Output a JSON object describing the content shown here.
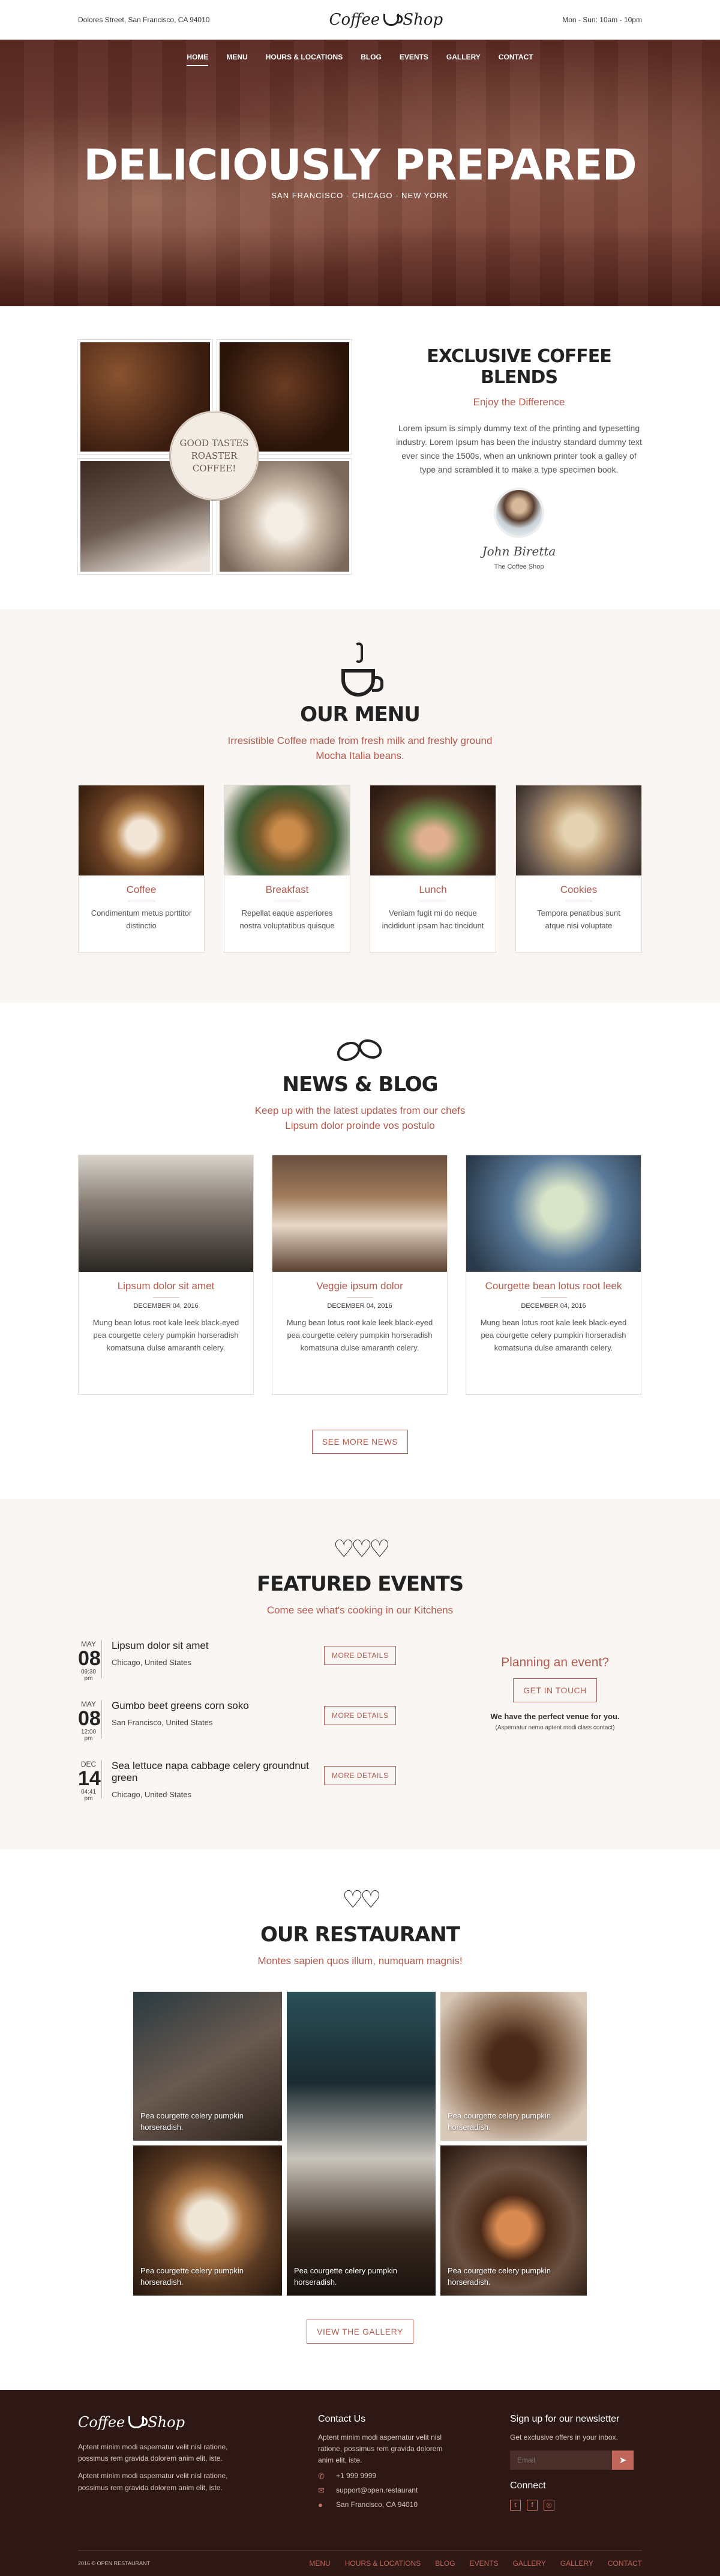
{
  "topbar": {
    "address": "Dolores Street, San Francisco, CA 94010",
    "brand_left": "Coffee",
    "brand_right": "Shop",
    "hours": "Mon - Sun: 10am - 10pm"
  },
  "nav": [
    "HOME",
    "MENU",
    "HOURS & LOCATIONS",
    "BLOG",
    "EVENTS",
    "GALLERY",
    "CONTACT"
  ],
  "hero": {
    "title": "DELICIOUSLY PREPARED",
    "subtitle": "SAN FRANCISCO - CHICAGO - NEW YORK"
  },
  "blends": {
    "badge_line1": "GOOD TASTES",
    "badge_line2": "ROASTER",
    "badge_line3": "COFFEE!",
    "title": "EXCLUSIVE COFFEE BLENDS",
    "tagline": "Enjoy the Difference",
    "text": "Lorem ipsum is simply dummy text of the printing and typesetting industry. Lorem Ipsum has been the industry standard dummy text ever since the 1500s, when an unknown printer took a galley of type and scrambled it to make a type specimen book.",
    "signature": "John Biretta",
    "role": "The Coffee Shop"
  },
  "menu": {
    "title": "OUR MENU",
    "tagline_line1": "Irresistible Coffee made from fresh milk and freshly ground",
    "tagline_line2": "Mocha Italia beans.",
    "items": [
      {
        "name": "Coffee",
        "desc": "Condimentum metus porttitor distinctio"
      },
      {
        "name": "Breakfast",
        "desc": "Repellat eaque asperiores nostra voluptatibus quisque"
      },
      {
        "name": "Lunch",
        "desc": "Veniam fugit mi do neque incididunt ipsam hac tincidunt"
      },
      {
        "name": "Cookies",
        "desc": "Tempora penatibus sunt atque nisi voluptate"
      }
    ]
  },
  "news": {
    "title": "NEWS & BLOG",
    "tagline_line1": "Keep up with the latest updates from our chefs",
    "tagline_line2": "Lipsum dolor proinde vos postulo",
    "posts": [
      {
        "title": "Lipsum dolor sit amet",
        "date": "DECEMBER 04, 2016",
        "text": "Mung bean lotus root kale leek black-eyed pea courgette celery pumpkin horseradish komatsuna dulse amaranth celery."
      },
      {
        "title": "Veggie ipsum dolor",
        "date": "DECEMBER 04, 2016",
        "text": "Mung bean lotus root kale leek black-eyed pea courgette celery pumpkin horseradish komatsuna dulse amaranth celery."
      },
      {
        "title": "Courgette bean lotus root leek",
        "date": "DECEMBER 04, 2016",
        "text": "Mung bean lotus root kale leek black-eyed pea courgette celery pumpkin horseradish komatsuna dulse amaranth celery."
      }
    ],
    "more_button": "SEE MORE NEWS"
  },
  "events": {
    "title": "FEATURED EVENTS",
    "tagline": "Come see what's cooking in our Kitchens",
    "list": [
      {
        "month": "MAY",
        "day": "08",
        "time": "09:30 pm",
        "name": "Lipsum dolor sit amet",
        "location": "Chicago, United States",
        "button": "MORE DETAILS"
      },
      {
        "month": "MAY",
        "day": "08",
        "time": "12:00 pm",
        "name": "Gumbo beet greens corn soko",
        "location": "San Francisco, United States",
        "button": "MORE DETAILS"
      },
      {
        "month": "DEC",
        "day": "14",
        "time": "04:41 pm",
        "name": "Sea lettuce napa cabbage celery groundnut green",
        "location": "Chicago, United States",
        "button": "MORE DETAILS"
      }
    ],
    "plan_title": "Planning an event?",
    "plan_button": "GET IN TOUCH",
    "venue_bold": "We have the perfect venue for you.",
    "venue_small": "(Aspernatur nemo aptent modi class contact)"
  },
  "restaurant": {
    "title": "OUR RESTAURANT",
    "tagline": "Montes sapien quos illum, numquam magnis!",
    "captions": [
      "Pea courgette celery pumpkin horseradish.",
      "Pea courgette celery pumpkin horseradish.",
      "Pea courgette celery pumpkin horseradish.",
      "Pea courgette celery pumpkin horseradish.",
      "Pea courgette celery pumpkin horseradish."
    ],
    "gallery_button": "VIEW THE GALLERY"
  },
  "footer": {
    "brand_left": "Coffee",
    "brand_right": "Shop",
    "about1": "Aptent minim modi aspernatur velit nisl ratione, possimus rem gravida dolorem anim elit, iste.",
    "about2": "Aptent minim modi aspernatur velit nisl ratione, possimus rem gravida dolorem anim elit, iste.",
    "contact_title": "Contact Us",
    "contact_text": "Aptent minim modi aspernatur velit nisl ratione, possimus rem gravida dolorem anim elit, iste.",
    "phone": "+1 999 9999",
    "email": "support@open.restaurant",
    "city": "San Francisco, CA 94010",
    "newsletter_title": "Sign up for our newsletter",
    "newsletter_text": "Get exclusive offers in your inbox.",
    "email_placeholder": "Email",
    "copyright": "2016 © OPEN RESTAURANT",
    "nav": [
      "MENU",
      "HOURS & LOCATIONS",
      "BLOG",
      "EVENTS",
      "GALLERY",
      "GALLERY",
      "CONTACT"
    ]
  },
  "colors": {
    "accent": "#b35a4d",
    "footer_bg": "#2e1816",
    "section_bg": "#faf6f4"
  }
}
